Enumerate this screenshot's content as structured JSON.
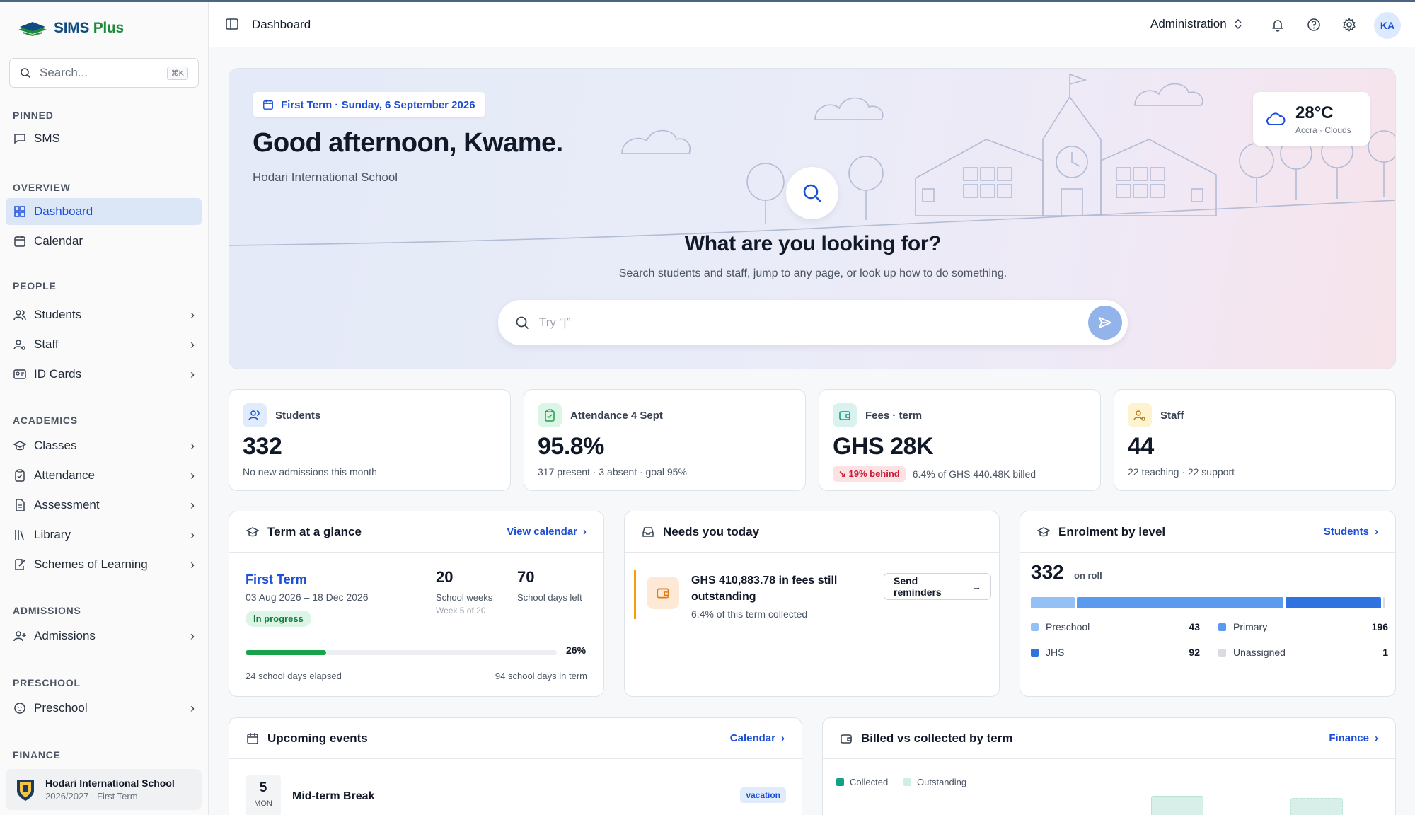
{
  "app": {
    "name_part1": "SIMS",
    "name_part2": "Plus"
  },
  "sidebar": {
    "search_placeholder": "Search...",
    "search_shortcut": "⌘K",
    "sections": {
      "pinned": "PINNED",
      "overview": "OVERVIEW",
      "people": "PEOPLE",
      "academics": "ACADEMICS",
      "admissions": "ADMISSIONS",
      "preschool": "PRESCHOOL",
      "finance": "FINANCE"
    },
    "items": {
      "sms": "SMS",
      "dashboard": "Dashboard",
      "calendar": "Calendar",
      "students": "Students",
      "staff": "Staff",
      "id_cards": "ID Cards",
      "classes": "Classes",
      "attendance": "Attendance",
      "assessment": "Assessment",
      "library": "Library",
      "schemes": "Schemes of Learning",
      "admissions": "Admissions",
      "preschool": "Preschool"
    },
    "school": {
      "name": "Hodari International School",
      "session": "2026/2027 · First Term"
    }
  },
  "topbar": {
    "title": "Dashboard",
    "role": "Administration",
    "avatar": "KA"
  },
  "hero": {
    "term_pill": "First Term · Sunday, 6 September 2026",
    "greeting": "Good afternoon, Kwame.",
    "school": "Hodari International School",
    "weather_temp": "28°C",
    "weather_desc": "Accra · Clouds",
    "question": "What are you looking for?",
    "help": "Search students and staff, jump to any page, or look up how to do something.",
    "search_placeholder": "Try “|”"
  },
  "stats": {
    "students": {
      "label": "Students",
      "value": "332",
      "sub": "No new admissions this month"
    },
    "attendance": {
      "label": "Attendance 4 Sept",
      "value": "95.8%",
      "sub": "317 present · 3 absent · goal 95%"
    },
    "fees": {
      "label": "Fees · term",
      "value": "GHS 28K",
      "badge": "↘ 19% behind",
      "sub": "6.4% of GHS 440.48K billed"
    },
    "staff": {
      "label": "Staff",
      "value": "44",
      "sub": "22 teaching · 22 support"
    }
  },
  "term_glance": {
    "title": "Term at a glance",
    "link": "View calendar",
    "term_name": "First Term",
    "dates": "03 Aug 2026 – 18 Dec 2026",
    "status": "In progress",
    "weeks_value": "20",
    "weeks_label": "School weeks",
    "weeks_sub": "Week 5 of 20",
    "days_left_value": "70",
    "days_left_label": "School days left",
    "progress_pct": 26,
    "progress_label": "26%",
    "elapsed": "24 school days elapsed",
    "total": "94 school days in term"
  },
  "needs_today": {
    "title": "Needs you today",
    "alert_title": "GHS 410,883.78 in fees still outstanding",
    "alert_sub": "6.4% of this term collected",
    "button": "Send reminders"
  },
  "enrolment": {
    "title": "Enrolment by level",
    "link": "Students",
    "total": "332",
    "total_label": "on roll",
    "levels": [
      {
        "name": "Preschool",
        "count": 43,
        "color": "#93c0f5"
      },
      {
        "name": "Primary",
        "count": 196,
        "color": "#5a9bf0"
      },
      {
        "name": "JHS",
        "count": 92,
        "color": "#2f73e0"
      },
      {
        "name": "Unassigned",
        "count": 1,
        "color": "#d9dde3"
      }
    ]
  },
  "events": {
    "title": "Upcoming events",
    "link": "Calendar",
    "items": [
      {
        "day": "5",
        "month": "MON",
        "name": "Mid-term Break",
        "tag": "vacation"
      }
    ]
  },
  "billed": {
    "title": "Billed vs collected by term",
    "link": "Finance",
    "legend_collected": "Collected",
    "legend_outstanding": "Outstanding",
    "colors": {
      "collected": "#14a085",
      "outstanding": "#cfeee5"
    }
  }
}
